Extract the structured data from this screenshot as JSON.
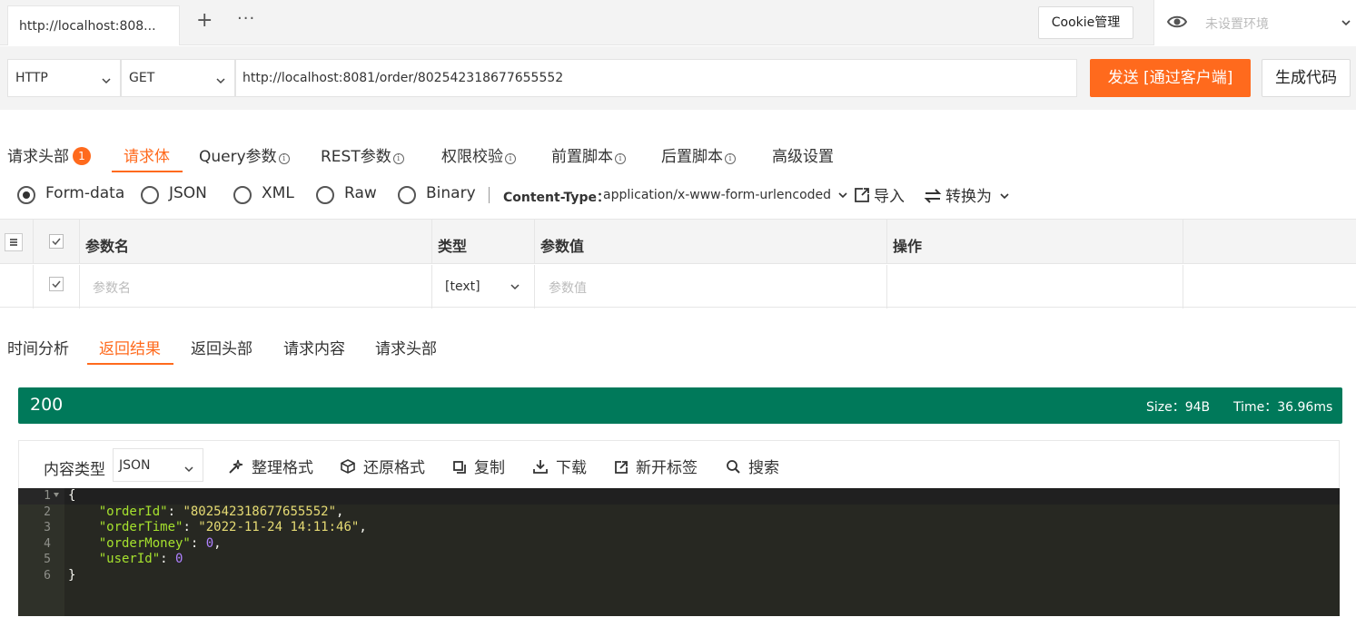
{
  "tabbar": {
    "tab_title": "http://localhost:808...",
    "add_symbol": "+",
    "more_symbol": "···",
    "cookie_button": "Cookie管理",
    "env_label": "未设置环境"
  },
  "request": {
    "protocol": "HTTP",
    "method": "GET",
    "url": "http://localhost:8081/order/802542318677655552",
    "send_button": "发送 [通过客户端]",
    "generate_button": "生成代码"
  },
  "req_tabs": [
    {
      "label": "请求头部",
      "badge": "1"
    },
    {
      "label": "请求体"
    },
    {
      "label": "Query参数"
    },
    {
      "label": "REST参数"
    },
    {
      "label": "权限校验"
    },
    {
      "label": "前置脚本"
    },
    {
      "label": "后置脚本"
    },
    {
      "label": "高级设置"
    }
  ],
  "info_symbol": "i",
  "body_types": [
    "Form-data",
    "JSON",
    "XML",
    "Raw",
    "Binary"
  ],
  "content_type": {
    "label": "Content-Type：",
    "value": "application/x-www-form-urlencoded"
  },
  "body_actions": {
    "import": "导入",
    "convert": "转换为"
  },
  "params_table": {
    "headers": [
      "参数名",
      "类型",
      "参数值",
      "操作"
    ],
    "row": {
      "name_placeholder": "参数名",
      "type": "[text]",
      "value_placeholder": "参数值"
    }
  },
  "response_tabs": [
    "时间分析",
    "返回结果",
    "返回头部",
    "请求内容",
    "请求头部"
  ],
  "status": {
    "code": "200",
    "size": "Size：94B",
    "time": "Time：36.96ms",
    "color": "#00795a"
  },
  "response_toolbar": {
    "content_type_label": "内容类型",
    "content_type_value": "JSON",
    "buttons": [
      "整理格式",
      "还原格式",
      "复制",
      "下载",
      "新开标签",
      "搜索"
    ]
  },
  "response_body": {
    "line_numbers": [
      "1",
      "2",
      "3",
      "4",
      "5",
      "6"
    ],
    "fields": [
      {
        "key": "\"orderId\"",
        "value": "\"802542318677655552\""
      },
      {
        "key": "\"orderTime\"",
        "value": "\"2022-11-24 14:11:46\""
      },
      {
        "key": "\"orderMoney\"",
        "value": "0"
      },
      {
        "key": "\"userId\"",
        "value": "0"
      }
    ],
    "open_brace": "{",
    "close_brace": "}"
  },
  "colors": {
    "accent": "#ff6a1d",
    "editor_bg": "#272822"
  }
}
